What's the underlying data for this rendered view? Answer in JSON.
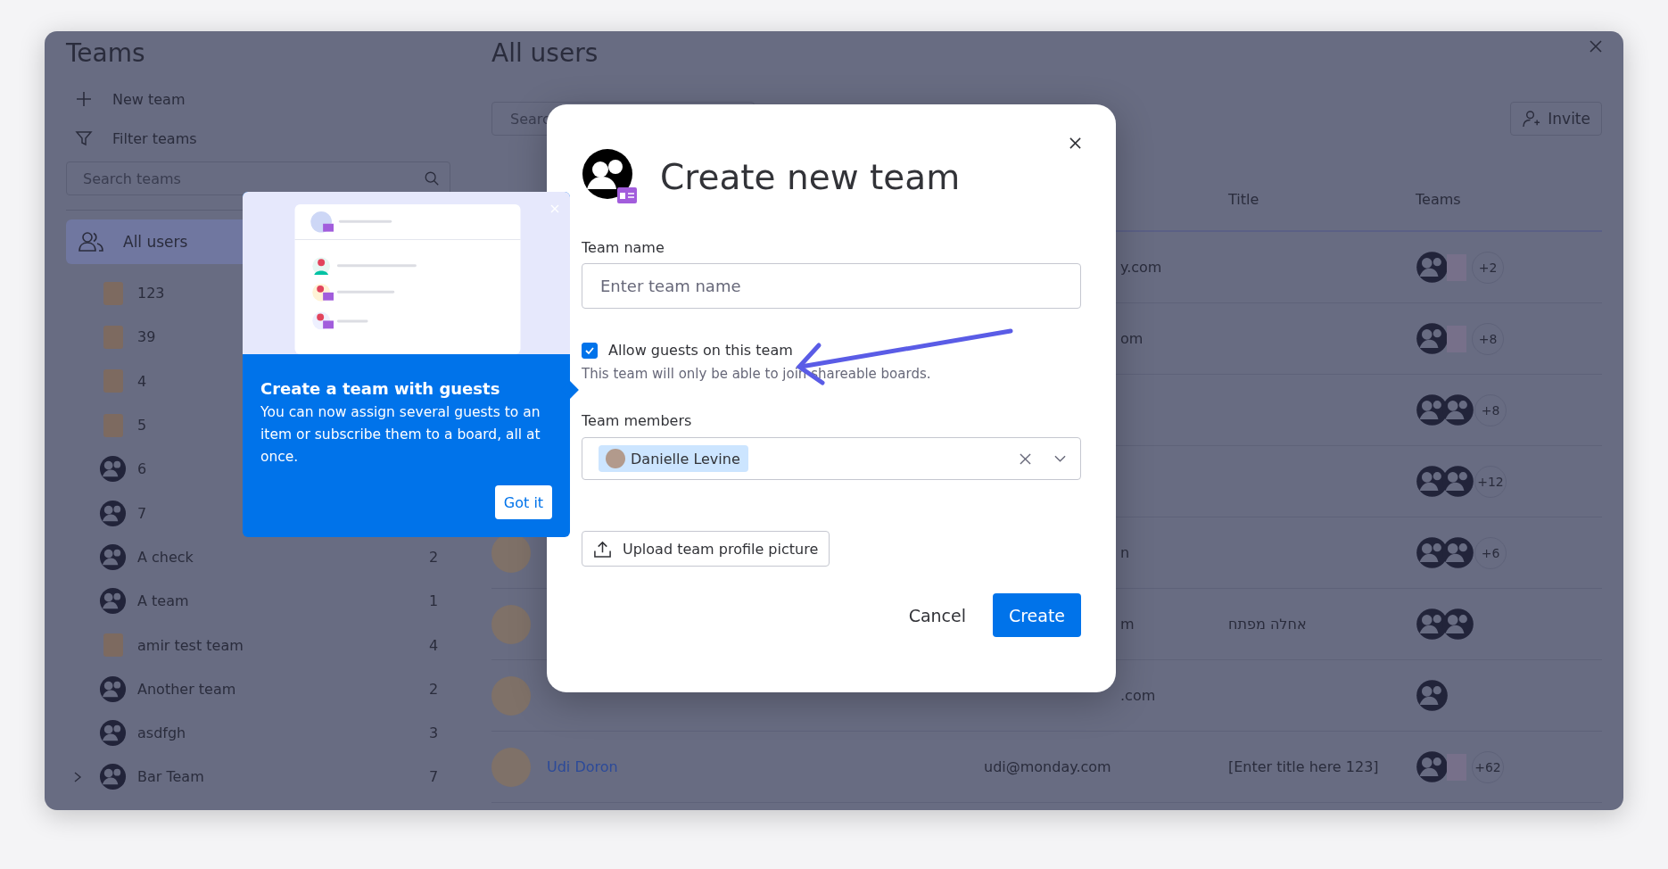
{
  "sidebar": {
    "title": "Teams",
    "actions": [
      {
        "kind": "add",
        "label": "New team"
      },
      {
        "kind": "filter",
        "label": "Filter teams"
      }
    ],
    "search": {
      "placeholder": "Search teams"
    },
    "all_users": {
      "label": "All users",
      "selected": true
    },
    "teams": [
      {
        "name": "123",
        "kind": "picture",
        "has_subteams": false
      },
      {
        "name": "39",
        "kind": "picture",
        "has_subteams": false
      },
      {
        "name": "4",
        "kind": "picture",
        "has_subteams": false
      },
      {
        "name": "5",
        "kind": "picture",
        "has_subteams": false
      },
      {
        "name": "6",
        "kind": "default",
        "has_subteams": false
      },
      {
        "name": "7",
        "kind": "default",
        "has_subteams": false
      },
      {
        "name": "A check",
        "kind": "default",
        "count": "2",
        "has_subteams": false
      },
      {
        "name": "A team",
        "kind": "default",
        "count": "1",
        "has_subteams": false
      },
      {
        "name": "amir test team",
        "kind": "picture",
        "count": "4",
        "has_subteams": false
      },
      {
        "name": "Another team",
        "kind": "default",
        "count": "2",
        "has_subteams": false
      },
      {
        "name": "asdfgh",
        "kind": "default",
        "count": "3",
        "has_subteams": false
      },
      {
        "name": "Bar Team",
        "kind": "default",
        "count": "7",
        "has_subteams": true
      }
    ]
  },
  "main": {
    "title": "All users",
    "search": {
      "placeholder": "Searc"
    },
    "invite_button": "Invite",
    "table": {
      "columns": [
        "Title",
        "Teams"
      ],
      "rows": [
        {
          "email": "y.com",
          "clipped": true,
          "teams": [
            {
              "kind": "default"
            },
            {
              "kind": "picture"
            }
          ],
          "more": "+2"
        },
        {
          "email": "om",
          "clipped": true,
          "teams": [
            {
              "kind": "default"
            },
            {
              "kind": "picture"
            }
          ],
          "more": "+8"
        },
        {
          "teams": [
            {
              "kind": "default"
            },
            {
              "kind": "default"
            }
          ],
          "more": "+8"
        },
        {
          "teams": [
            {
              "kind": "default"
            },
            {
              "kind": "default"
            }
          ],
          "more": "+12"
        },
        {
          "photo": true,
          "email": "n",
          "clipped": true,
          "teams": [
            {
              "kind": "default"
            },
            {
              "kind": "default"
            }
          ],
          "more": "+6"
        },
        {
          "photo": true,
          "email": "m",
          "clipped": true,
          "title": "אחלה מפתח",
          "teams": [
            {
              "kind": "default"
            },
            {
              "kind": "default"
            }
          ]
        },
        {
          "photo": true,
          "email": ".com",
          "clipped": true,
          "teams": [
            {
              "kind": "default"
            }
          ]
        },
        {
          "photo": true,
          "name": "Udi Doron",
          "email": "udi@monday.com",
          "clipped": false,
          "title": "[Enter title here 123]",
          "teams": [
            {
              "kind": "default"
            },
            {
              "kind": "picture"
            }
          ],
          "more": "+62"
        }
      ]
    }
  },
  "tooltip": {
    "title": "Create a team with guests",
    "body": "You can now assign several guests to an item or subscribe them to a board, all at once.",
    "button": "Got it"
  },
  "modal": {
    "title": "Create new team",
    "team_name": {
      "label": "Team name",
      "placeholder": "Enter team name"
    },
    "guests": {
      "label": "Allow guests on this team",
      "checked": true,
      "note": "This team will only be able to join shareable boards."
    },
    "members": {
      "label": "Team members",
      "chips": [
        "Danielle Levine"
      ]
    },
    "upload_button": "Upload team profile picture",
    "cancel_button": "Cancel",
    "create_button": "Create"
  }
}
